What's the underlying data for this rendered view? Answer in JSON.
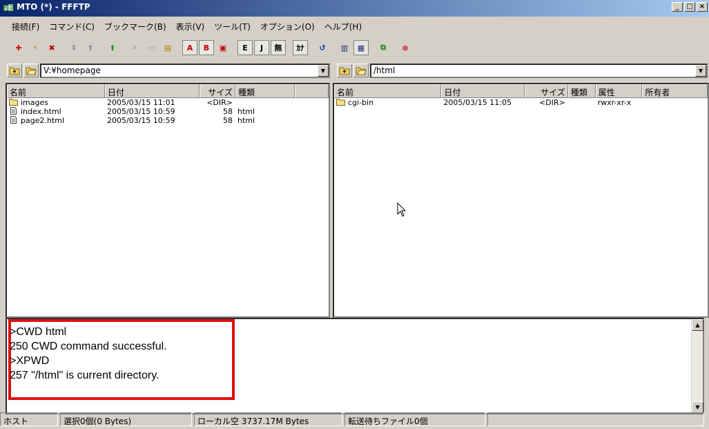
{
  "window": {
    "title": "MTO (*) - FFFTP",
    "controls": [
      "_",
      "□",
      "×"
    ]
  },
  "menu": [
    "接続(F)",
    "コマンド(C)",
    "ブックマーク(B)",
    "表示(V)",
    "ツール(T)",
    "オプション(O)",
    "ヘルプ(H)"
  ],
  "toolbar": {
    "buttons": [
      {
        "name": "connect-icon",
        "glyph": "✚",
        "color": "#d01010"
      },
      {
        "name": "quick-connect-icon",
        "glyph": "⚡",
        "color": "#c08000"
      },
      {
        "name": "disconnect-icon",
        "glyph": "✖",
        "color": "#c00000"
      },
      {
        "name": "download-icon",
        "glyph": "⬇",
        "color": "#9090a0"
      },
      {
        "name": "upload-icon",
        "glyph": "⬆",
        "color": "#9090a0"
      },
      {
        "name": "mirror-upload-icon",
        "glyph": "⬆",
        "color": "#1aa01a"
      },
      {
        "name": "delete-icon",
        "glyph": "✕",
        "color": "#a0a0a0"
      },
      {
        "name": "rename-icon",
        "glyph": "▭",
        "color": "#a0a0a0"
      },
      {
        "name": "mkdir-icon",
        "glyph": "▤",
        "color": "#b08000"
      },
      {
        "name": "ascii-mode-icon",
        "glyph": "A",
        "color": "#c00000"
      },
      {
        "name": "binary-mode-icon",
        "glyph": "B",
        "color": "#c00000"
      },
      {
        "name": "auto-mode-icon",
        "glyph": "▣",
        "color": "#c00000"
      },
      {
        "name": "euc-icon",
        "glyph": "E",
        "color": "#000000"
      },
      {
        "name": "jis-icon",
        "glyph": "J",
        "color": "#000000"
      },
      {
        "name": "no-convert-icon",
        "glyph": "無",
        "color": "#000000"
      },
      {
        "name": "kana-icon",
        "glyph": "ｶﾅ",
        "color": "#000000"
      },
      {
        "name": "refresh-icon",
        "glyph": "↺",
        "color": "#1030c0"
      },
      {
        "name": "list-view-icon",
        "glyph": "▥",
        "color": "#203080"
      },
      {
        "name": "detail-view-icon",
        "glyph": "▦",
        "color": "#203080"
      },
      {
        "name": "sync-icon",
        "glyph": "⧉",
        "color": "#109010"
      },
      {
        "name": "stop-icon",
        "glyph": "⊗",
        "color": "#d01010"
      }
    ]
  },
  "local": {
    "path": "V:¥homepage",
    "headers": [
      "名前",
      "日付",
      "サイズ",
      "種類"
    ],
    "files": [
      {
        "name": "images",
        "date": "2005/03/15 11:01",
        "size": "<DIR>",
        "type": "",
        "kind": "folder"
      },
      {
        "name": "index.html",
        "date": "2005/03/15 10:59",
        "size": "58",
        "type": "html",
        "kind": "file"
      },
      {
        "name": "page2.html",
        "date": "2005/03/15 10:59",
        "size": "58",
        "type": "html",
        "kind": "file"
      }
    ]
  },
  "remote": {
    "path": "/html",
    "headers": [
      "名前",
      "日付",
      "サイズ",
      "種類",
      "属性",
      "所有者"
    ],
    "files": [
      {
        "name": "cgi-bin",
        "date": "2005/03/15 11:05",
        "size": "<DIR>",
        "type": "",
        "attr": "rwxr-xr-x",
        "owner": "",
        "kind": "folder"
      }
    ]
  },
  "log": {
    "lines": [
      ">CWD html",
      "250 CWD command successful.",
      ">XPWD",
      "257 \"/html\" is current directory."
    ]
  },
  "status": {
    "host": "ホスト",
    "selection": "選択0個(0 Bytes)",
    "local_free": "ローカル空 3737.17M Bytes",
    "queue": "転送待ちファイル0個"
  },
  "colors": {
    "highlight": "#e01010",
    "titlebar_start": "#0a246a",
    "titlebar_end": "#a6caf0"
  }
}
